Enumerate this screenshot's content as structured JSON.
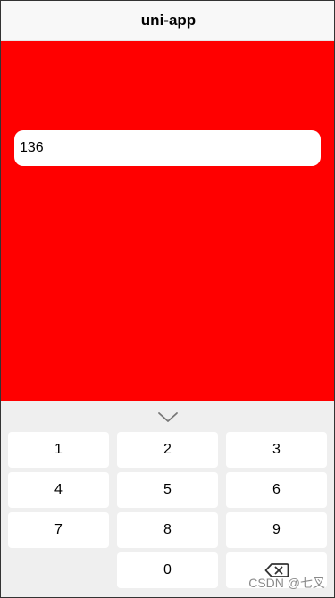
{
  "navbar": {
    "title": "uni-app"
  },
  "input": {
    "value": "136"
  },
  "keyboard": {
    "collapse_icon": "chevron-down-icon",
    "rows": [
      [
        "1",
        "2",
        "3"
      ],
      [
        "4",
        "5",
        "6"
      ],
      [
        "7",
        "8",
        "9"
      ],
      [
        "",
        "0",
        "backspace"
      ]
    ],
    "keys": {
      "k1": "1",
      "k2": "2",
      "k3": "3",
      "k4": "4",
      "k5": "5",
      "k6": "6",
      "k7": "7",
      "k8": "8",
      "k9": "9",
      "k0": "0"
    },
    "backspace_icon": "backspace-icon"
  },
  "watermark": "CSDN @七叉",
  "colors": {
    "content_background": "#ff0000",
    "navbar_background": "#f8f8f8",
    "keyboard_background": "#efefef",
    "key_background": "#ffffff"
  }
}
